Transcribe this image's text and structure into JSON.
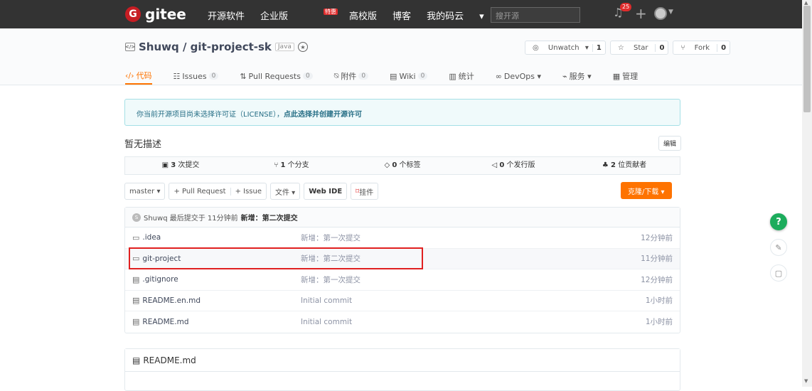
{
  "topbar": {
    "logo_text": "gitee",
    "logo_letter": "G",
    "nav": [
      "开源软件",
      "企业版",
      "高校版",
      "博客",
      "我的码云"
    ],
    "nav_caret": "▾",
    "hot_badge": "特惠",
    "search_placeholder": "搜开源",
    "notif_count": "25",
    "plus": "+"
  },
  "repo": {
    "owner_name": "Shuwq / git-project-sk",
    "lang": "Java",
    "watch_label": "Unwatch",
    "watch_count": "1",
    "star_label": "Star",
    "star_count": "0",
    "fork_label": "Fork",
    "fork_count": "0"
  },
  "tabs": [
    {
      "label": "代码"
    },
    {
      "label": "Issues",
      "count": "0"
    },
    {
      "label": "Pull Requests",
      "count": "0"
    },
    {
      "label": "附件",
      "count": "0"
    },
    {
      "label": "Wiki",
      "count": "0"
    },
    {
      "label": "统计"
    },
    {
      "label": "DevOps ▾"
    },
    {
      "label": "服务 ▾"
    },
    {
      "label": "管理"
    }
  ],
  "license": {
    "text": "你当前开源项目尚未选择许可证（LICENSE），",
    "link": "点此选择并创建开源许可"
  },
  "description": "暂无描述",
  "edit_label": "编辑",
  "stats": [
    {
      "num": "3",
      "label": "次提交"
    },
    {
      "num": "1",
      "label": "个分支"
    },
    {
      "num": "0",
      "label": "个标签"
    },
    {
      "num": "0",
      "label": "个发行版"
    },
    {
      "num": "2",
      "label": "位贡献者"
    }
  ],
  "toolbar": {
    "branch": "master ▾",
    "pull_request": "+ Pull Request",
    "issue": "+ Issue",
    "file": "文件 ▾",
    "webide": "Web IDE",
    "pin": "挂件",
    "clone": "克隆/下载 ▾"
  },
  "last_commit": {
    "avatar_letter": "S",
    "text": "Shuwq 最后提交于 11分钟前",
    "message": "新增：第二次提交"
  },
  "files": [
    {
      "name": ".idea",
      "type": "folder",
      "msg": "新增：第一次提交",
      "time": "12分钟前"
    },
    {
      "name": "git-project",
      "type": "folder",
      "msg": "新增：第二次提交",
      "time": "11分钟前"
    },
    {
      "name": ".gitignore",
      "type": "file",
      "msg": "新增：第一次提交",
      "time": "12分钟前"
    },
    {
      "name": "README.en.md",
      "type": "file",
      "msg": "Initial commit",
      "time": "1小时前"
    },
    {
      "name": "README.md",
      "type": "file",
      "msg": "Initial commit",
      "time": "1小时前"
    }
  ],
  "readme_title": "README.md",
  "float_help": "?"
}
